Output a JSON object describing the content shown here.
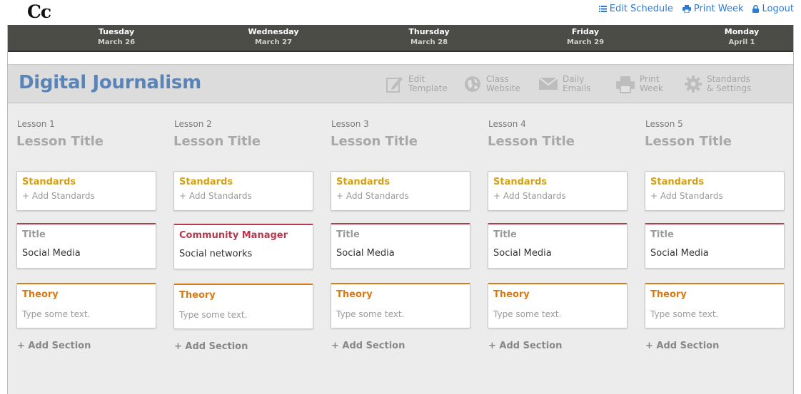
{
  "app": {
    "logo": "Cc"
  },
  "toplinks": [
    {
      "label": "Edit Schedule",
      "icon": "list-icon"
    },
    {
      "label": "Print Week",
      "icon": "printer-icon"
    },
    {
      "label": "Logout",
      "icon": "lock-icon"
    }
  ],
  "days": [
    {
      "name": "Tuesday",
      "date": "March 26"
    },
    {
      "name": "Wednesday",
      "date": "March 27"
    },
    {
      "name": "Thursday",
      "date": "March 28"
    },
    {
      "name": "Friday",
      "date": "March 29"
    },
    {
      "name": "Monday",
      "date": "April 1"
    }
  ],
  "class": {
    "name": "Digital Journalism"
  },
  "toolbar": [
    {
      "line1": "Edit",
      "line2": "Template",
      "icon": "edit-template-icon"
    },
    {
      "line1": "Class",
      "line2": "Website",
      "icon": "globe-icon"
    },
    {
      "line1": "Daily",
      "line2": "Emails",
      "icon": "envelope-icon"
    },
    {
      "line1": "Print",
      "line2": "Week",
      "icon": "printer-icon"
    },
    {
      "line1": "Standards",
      "line2": "& Settings",
      "icon": "gear-icon"
    }
  ],
  "colors": {
    "title_accent": "#b63a4f",
    "theory_accent": "#d67917",
    "standards_accent": "#d4a013",
    "class_name": "#5a84b8",
    "link": "#2a7bd6",
    "daybar": "#4b4b47"
  },
  "lessons": [
    {
      "number": "Lesson 1",
      "title": "Lesson Title",
      "standards": {
        "heading": "Standards",
        "add": "+ Add Standards"
      },
      "title_section": {
        "heading": "Title",
        "value": "Social Media"
      },
      "theory": {
        "heading": "Theory",
        "placeholder": "Type some text."
      },
      "add_section": "+ Add Section"
    },
    {
      "number": "Lesson 2",
      "title": "Lesson Title",
      "standards": {
        "heading": "Standards",
        "add": "+ Add Standards"
      },
      "title_section": {
        "heading": "Community Manager",
        "value": "Social networks"
      },
      "theory": {
        "heading": "Theory",
        "placeholder": "Type some text."
      },
      "add_section": "+ Add Section"
    },
    {
      "number": "Lesson 3",
      "title": "Lesson Title",
      "standards": {
        "heading": "Standards",
        "add": "+ Add Standards"
      },
      "title_section": {
        "heading": "Title",
        "value": "Social Media"
      },
      "theory": {
        "heading": "Theory",
        "placeholder": "Type some text."
      },
      "add_section": "+ Add Section"
    },
    {
      "number": "Lesson 4",
      "title": "Lesson Title",
      "standards": {
        "heading": "Standards",
        "add": "+ Add Standards"
      },
      "title_section": {
        "heading": "Title",
        "value": "Social Media"
      },
      "theory": {
        "heading": "Theory",
        "placeholder": "Type some text."
      },
      "add_section": "+ Add Section"
    },
    {
      "number": "Lesson 5",
      "title": "Lesson Title",
      "standards": {
        "heading": "Standards",
        "add": "+ Add Standards"
      },
      "title_section": {
        "heading": "Title",
        "value": "Social Media"
      },
      "theory": {
        "heading": "Theory",
        "placeholder": "Type some text."
      },
      "add_section": "+ Add Section"
    }
  ]
}
